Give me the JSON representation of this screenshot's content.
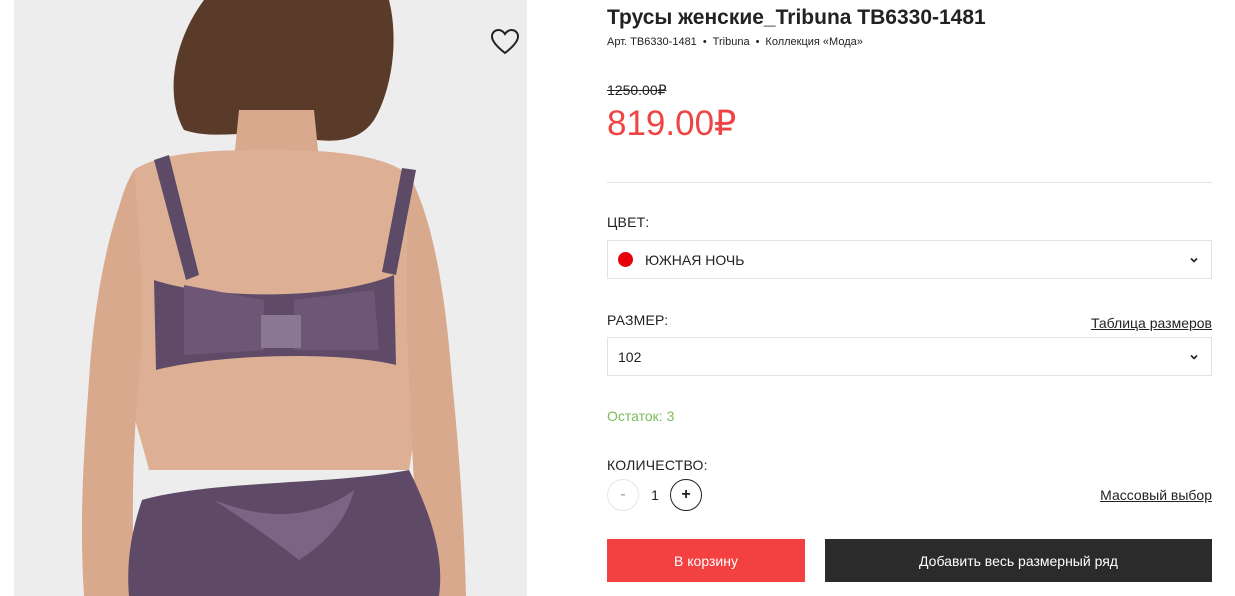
{
  "product": {
    "title": "Трусы женские_Tribuna TB6330-1481",
    "article": "Арт. TB6330-1481",
    "brand": "Tribuna",
    "collection": "Коллекция «Мода»",
    "dot": "•"
  },
  "price": {
    "old": "1250.00₽",
    "current": "819.00₽",
    "accent_color": "#ef4444"
  },
  "color": {
    "label": "ЦВЕТ:",
    "selected": "ЮЖНАЯ НОЧЬ",
    "swatch": "#e8000b"
  },
  "size": {
    "label": "РАЗМЕР:",
    "selected": "102",
    "table_link": "Таблица размеров"
  },
  "stock": {
    "text": "Остаток: 3",
    "color": "#7dbb5e"
  },
  "quantity": {
    "label": "КОЛИЧЕСТВО:",
    "minus": "-",
    "value": "1",
    "plus": "+",
    "mass_link": "Массовый выбор"
  },
  "actions": {
    "add_to_cart": "В корзину",
    "add_all_sizes": "Добавить весь размерный ряд"
  },
  "icons": {
    "favorite": "heart-icon",
    "dropdown": "chevron-down-icon"
  }
}
